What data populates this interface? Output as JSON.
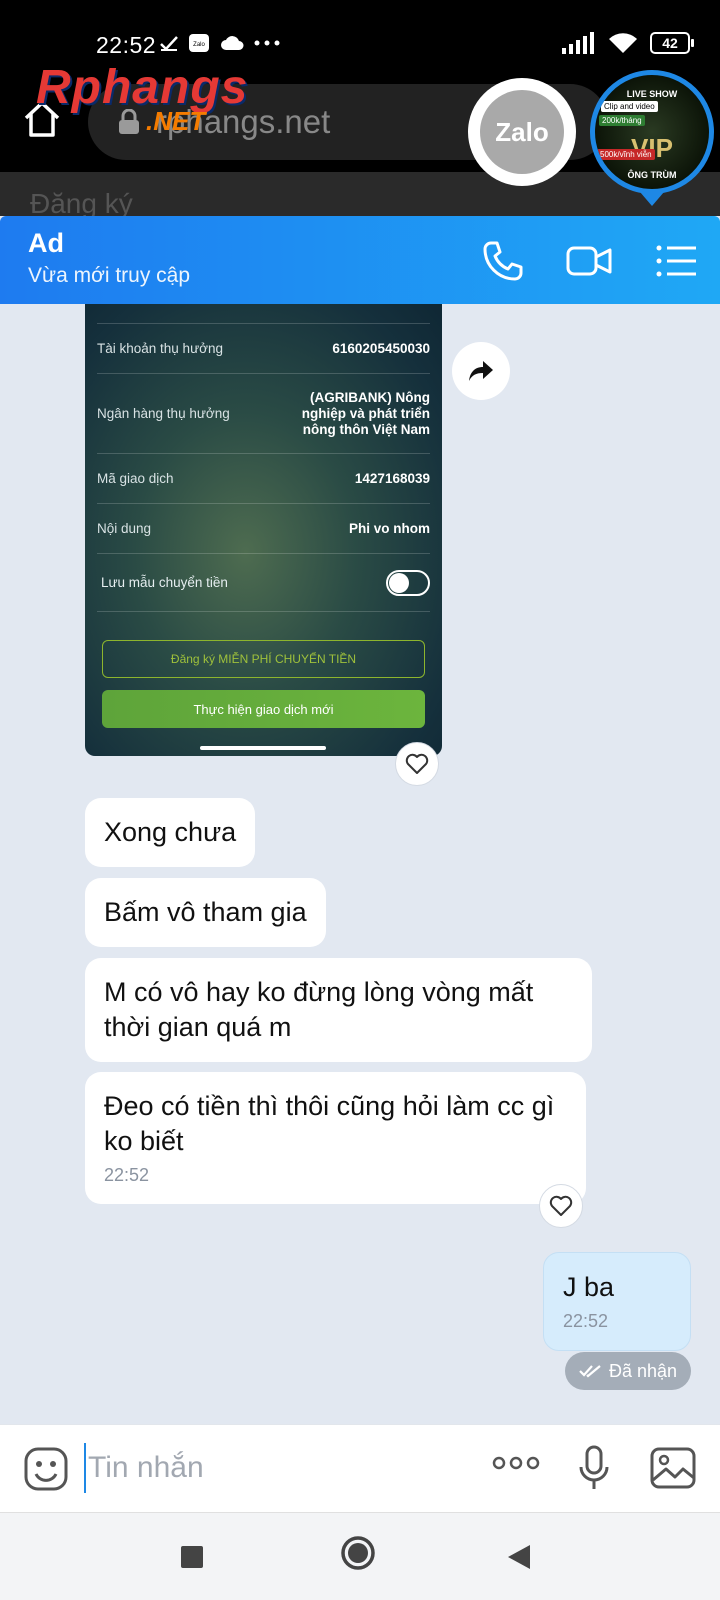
{
  "status_bar": {
    "time": "22:52",
    "battery": "42"
  },
  "browser": {
    "url": "rphangs.net",
    "logo_main": "Rphangs",
    "logo_sub": ".NET",
    "page_peek_text": "Đăng ký"
  },
  "floating_bubbles": {
    "zalo_label": "Zalo",
    "vip": {
      "top": "LIVE SHOW",
      "tag1": "Clip and video",
      "tag2": "200k/tháng",
      "tag3": "500k/vĩnh viễn",
      "main": "VIP",
      "bottom": "ÔNG TRÙM"
    }
  },
  "chat_header": {
    "name": "Ad",
    "status": "Vừa mới truy cập"
  },
  "bank_receipt": {
    "rows": [
      {
        "label": "Tài khoản thụ hưởng",
        "value": "6160205450030"
      },
      {
        "label": "Ngân hàng thụ hưởng",
        "value": "(AGRIBANK) Nông nghiệp và phát triển nông thôn Việt Nam"
      },
      {
        "label": "Mã giao dịch",
        "value": "1427168039"
      },
      {
        "label": "Nội dung",
        "value": "Phi vo nhom"
      }
    ],
    "save_template_label": "Lưu mẫu chuyển tiền",
    "register_button": "Đăng ký MIỄN PHÍ CHUYỂN TIỀN",
    "new_transaction_button": "Thực hiện giao dịch mới"
  },
  "messages": [
    {
      "text": "Xong chưa"
    },
    {
      "text": "Bấm vô tham gia"
    },
    {
      "text": "M có vô hay ko đừng lòng vòng mất thời gian quá m"
    },
    {
      "text": "Đeo có tiền thì thôi cũng hỏi làm cc gì ko biết",
      "time": "22:52"
    }
  ],
  "my_message": {
    "text": "J ba",
    "time": "22:52"
  },
  "delivered_label": "Đã nhận",
  "input": {
    "placeholder": "Tin nhắn"
  }
}
